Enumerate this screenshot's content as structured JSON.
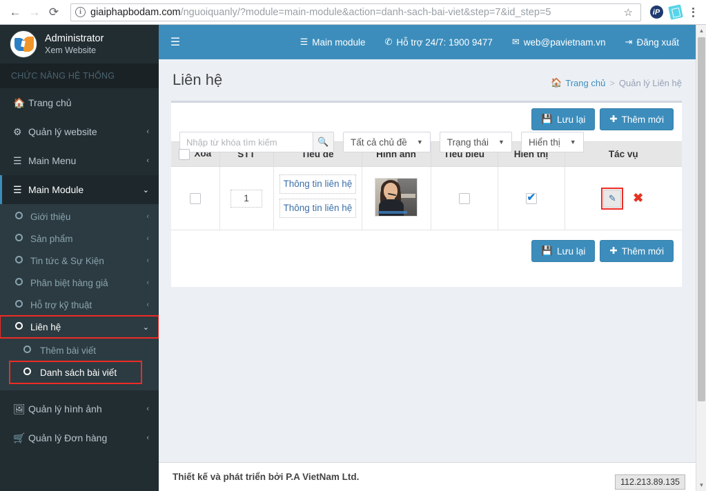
{
  "browser": {
    "back_icon": "back-arrow",
    "forward_icon": "forward-arrow",
    "reload_icon": "reload",
    "url_host": "giaiphapbodam.com",
    "url_path": "/nguoiquanly/?module=main-module&action=danh-sach-bai-viet&step=7&id_step=5",
    "star_icon": "☆",
    "ext_ip_label": "iP",
    "ext_note_label": "note-ext",
    "menu_icon": "kebab-menu"
  },
  "sidebar": {
    "user": {
      "name": "Administrator",
      "subtitle": "Xem Website"
    },
    "section_header": "CHỨC NĂNG HỆ THỐNG",
    "items": [
      {
        "label": "Trang chủ",
        "icon": "home-icon",
        "arrow": ""
      },
      {
        "label": "Quản lý website",
        "icon": "dashboard-icon",
        "arrow": "‹"
      },
      {
        "label": "Main Menu",
        "icon": "sliders-icon",
        "arrow": "‹"
      },
      {
        "label": "Main Module",
        "icon": "bars-icon",
        "arrow": "⌄",
        "active": true
      }
    ],
    "submenu": [
      {
        "label": "Giới thiệu",
        "arrow": "‹"
      },
      {
        "label": "Sản phẩm",
        "arrow": "‹"
      },
      {
        "label": "Tin tức & Sự Kiện",
        "arrow": "‹"
      },
      {
        "label": "Phân biệt hàng giả",
        "arrow": "‹"
      },
      {
        "label": "Hỗ trợ kỹ thuật",
        "arrow": "‹"
      },
      {
        "label": "Liên hệ",
        "arrow": "⌄",
        "highlighted": true
      }
    ],
    "submenu_children": [
      {
        "label": "Thêm bài viết"
      },
      {
        "label": "Danh sách bài viết",
        "highlighted": true
      }
    ],
    "items_bottom": [
      {
        "label": "Quản lý hình ảnh",
        "icon": "image-icon",
        "arrow": "‹"
      },
      {
        "label": "Quản lý Đơn hàng",
        "icon": "cart-icon",
        "arrow": "‹"
      }
    ]
  },
  "topnav": {
    "hamburger_icon": "hamburger-icon",
    "items": [
      {
        "label": "Main module",
        "icon": "bars-icon"
      },
      {
        "label": "Hỗ trợ 24/7: 1900 9477",
        "icon": "phone-icon"
      },
      {
        "label": "web@pavietnam.vn",
        "icon": "envelope-icon"
      },
      {
        "label": "Đăng xuất",
        "icon": "logout-icon"
      }
    ]
  },
  "content": {
    "page_title": "Liên hệ",
    "breadcrumb": {
      "home": "Trang chủ",
      "separator": ">",
      "current": "Quản lý Liên hệ"
    },
    "toolbar": {
      "save_label": "Lưu lại",
      "save_icon": "floppy-icon",
      "add_label": "Thêm mới",
      "add_icon": "plus-icon"
    },
    "filters": {
      "search_placeholder": "Nhập từ khóa tìm kiếm",
      "search_value": "",
      "search_icon": "search-icon",
      "topic_select": "Tất cả chủ đề",
      "status_select": "Trạng thái",
      "display_select": "Hiển thị",
      "caret": "▼"
    },
    "table": {
      "headers": [
        "Xóa",
        "STT",
        "Tiêu đề",
        "Hình ảnh",
        "Tiêu biểu",
        "Hiển thị",
        "Tác vụ"
      ],
      "rows": [
        {
          "delete_checked": false,
          "stt": "1",
          "title_1": "Thông tin liên hệ",
          "title_2": "Thông tin liên hệ",
          "image_alt": "contact-thumbnail",
          "featured_checked": false,
          "visible_checked": true,
          "edit_icon": "edit-icon",
          "delete_icon": "delete-icon"
        }
      ]
    }
  },
  "footer": {
    "text": "Thiết kế và phát triển bởi P.A VietNam Ltd.",
    "ip": "112.213.89.135"
  },
  "colors": {
    "header_blue": "#3c8dbc",
    "sidebar_dark": "#222d32",
    "submenu_dark": "#2c3b41",
    "highlight_red": "#ee2b25",
    "body_bg": "#ecf0f5"
  }
}
